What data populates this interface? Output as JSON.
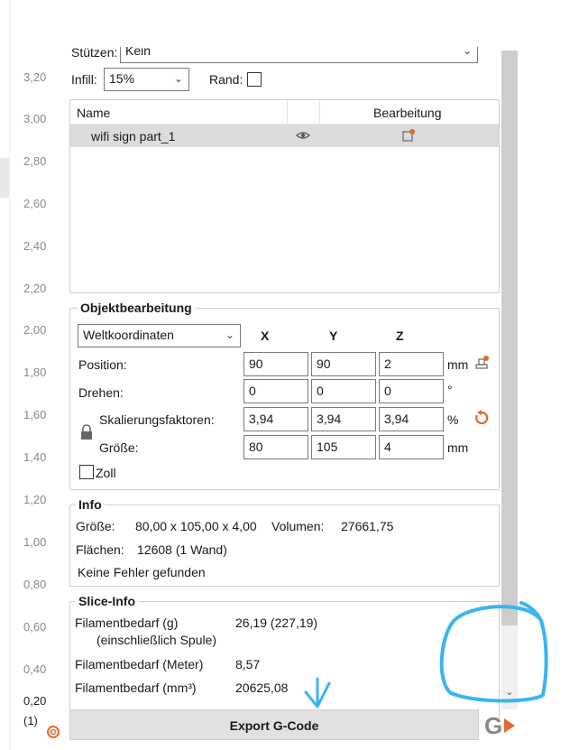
{
  "ruler": {
    "labels": [
      "3,20",
      "3,00",
      "2,80",
      "2,60",
      "2,40",
      "2,20",
      "2,00",
      "1,80",
      "1,60",
      "1,40",
      "1,20",
      "1,00",
      "0,80",
      "0,60",
      "0,40",
      "0,20",
      "(1)"
    ]
  },
  "settings": {
    "stuetzen_label": "Stützen:",
    "stuetzen_value": "Kein",
    "infill_label": "Infill:",
    "infill_value": "15%",
    "rand_label": "Rand:"
  },
  "object_list": {
    "columns": [
      "Name",
      "Bearbeitung"
    ],
    "rows": [
      {
        "name": "wifi sign part_1"
      }
    ]
  },
  "objektbearbeitung": {
    "title": "Objektbearbeitung",
    "coord_system": "Weltkoordinaten",
    "axes": [
      "X",
      "Y",
      "Z"
    ],
    "rows": [
      {
        "label": "Position:",
        "values": [
          "90",
          "90",
          "2"
        ],
        "unit": "mm"
      },
      {
        "label": "Drehen:",
        "values": [
          "0",
          "0",
          "0"
        ],
        "unit": "°"
      },
      {
        "label": "Skalierungsfaktoren:",
        "values": [
          "3,94",
          "3,94",
          "3,94"
        ],
        "unit": "%"
      },
      {
        "label": "Größe:",
        "values": [
          "80",
          "105",
          "4"
        ],
        "unit": "mm"
      }
    ],
    "zoll_label": "Zoll"
  },
  "info": {
    "title": "Info",
    "groesse_label": "Größe:",
    "groesse_value": "80,00 x 105,00 x 4,00",
    "volumen_label": "Volumen:",
    "volumen_value": "27661,75",
    "flaechen_label": "Flächen:",
    "flaechen_value": "12608 (1 Wand)",
    "fehler": "Keine Fehler gefunden"
  },
  "slice_info": {
    "title": "Slice-Info",
    "rows": [
      {
        "label": "Filamentbedarf (g)",
        "sub": "(einschließlich Spule)",
        "value": "26,19 (227,19)"
      },
      {
        "label": "Filamentbedarf (Meter)",
        "value": "8,57"
      },
      {
        "label": "Filamentbedarf (mm³)",
        "value": "20625,08"
      }
    ]
  },
  "export": {
    "label": "Export G-Code"
  },
  "colors": {
    "accent_orange": "#e8672a",
    "annotation_blue": "#3ab4f0"
  }
}
